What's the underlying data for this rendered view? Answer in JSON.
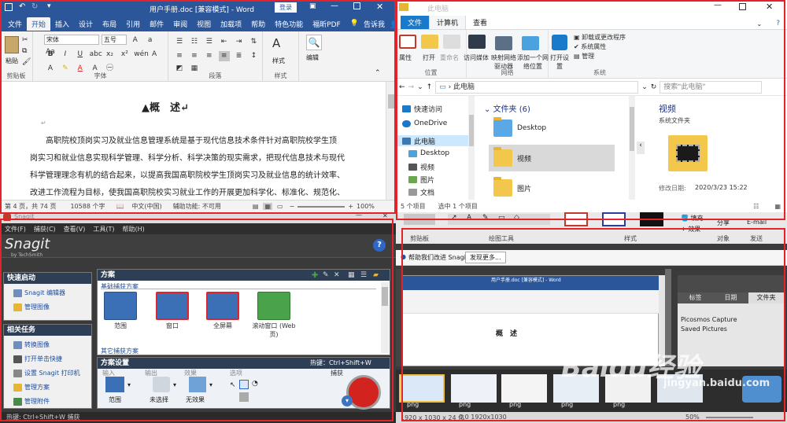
{
  "word": {
    "title": "用户手册.doc [兼容模式] - Word",
    "login": "登录",
    "tabs": [
      "文件",
      "开始",
      "插入",
      "设计",
      "布局",
      "引用",
      "邮件",
      "审阅",
      "视图",
      "加载项",
      "帮助",
      "特色功能",
      "福昕PDF"
    ],
    "tell_me": "告诉我",
    "share": "共享",
    "font_name": "宋体",
    "font_size": "五号",
    "paste": "粘贴",
    "styles": "样式",
    "edit": "编辑",
    "group_labels": [
      "剪贴板",
      "字体",
      "段落",
      "样式"
    ],
    "heading": "▲概　述↵",
    "paragraph_lines": [
      "高职院校顶岗实习及就业信息管理系统是基于现代信息技术条件针对高职院校学生顶",
      "岗实习和就业信息实现科学管理、科学分析、科学决策的现实需求，把现代信息技术与现代",
      "科学管理理念有机的结合起来，以提高我国高职院校学生顶岗实习及就业信息的统计效率、",
      "改进工作流程为目标，使我国高职院校实习就业工作的开展更加科学化、标准化、规范化、"
    ],
    "status": {
      "page": "第 4 页，共 74 页",
      "words": "10588 个字",
      "lang": "中文(中国)",
      "accessibility": "辅助功能: 不可用",
      "zoom": "100%"
    }
  },
  "explorer": {
    "title": "此电脑",
    "tabs": [
      "文件",
      "计算机",
      "查看"
    ],
    "ribbon_items": [
      "属性",
      "打开",
      "重命名",
      "访问媒体",
      "映射网络驱动器",
      "添加一个网络位置",
      "打开设置",
      "卸载或更改程序",
      "系统属性",
      "管理"
    ],
    "group_labels": [
      "位置",
      "网络",
      "系统"
    ],
    "address": "此电脑",
    "search_placeholder": "搜索\"此电脑\"",
    "nav_items": [
      "快速访问",
      "OneDrive",
      "此电脑",
      "Desktop",
      "视频",
      "图片",
      "文档"
    ],
    "section": "文件夹 (6)",
    "folders": [
      "Desktop",
      "视频",
      "图片"
    ],
    "preview": {
      "name": "视频",
      "type": "系统文件夹",
      "modified_label": "修改日期:",
      "modified": "2020/3/23 15:22"
    },
    "status": {
      "count": "5 个项目",
      "selected": "选中 1 个项目"
    }
  },
  "snagit": {
    "title": "Snagit",
    "menu": [
      "文件(F)",
      "捕获(C)",
      "查看(V)",
      "工具(T)",
      "帮助(H)"
    ],
    "logo": "Snagit",
    "logo_sub": "by TechSmith",
    "quick_start": {
      "title": "快速启动",
      "items": [
        "Snagit 编辑器",
        "管理图像"
      ]
    },
    "related": {
      "title": "相关任务",
      "items": [
        "转换图像",
        "打开单击快捷",
        "设置 Snagit 打印机",
        "管理方案",
        "管理附件"
      ]
    },
    "schemes": {
      "title": "方案",
      "basic": "基础捕获方案",
      "other": "其它捕获方案",
      "presets": [
        "范围",
        "窗口",
        "全屏幕",
        "滚动窗口 (Web\n页)"
      ]
    },
    "settings": {
      "title": "方案设置",
      "hotkey": "热键：Ctrl+Shift+W",
      "input": "输入",
      "output": "输出",
      "effect": "效果",
      "options": "选项",
      "capture": "捕获",
      "values": [
        "范围",
        "未选择",
        "无效果"
      ]
    },
    "status": "热键: Ctrl+Shift+W 捕获"
  },
  "editor": {
    "ribbon_labels": [
      "剪贴板",
      "绘图工具",
      "样式",
      "对象",
      "发送"
    ],
    "fill": "填充",
    "effects": "效果",
    "share": "分享",
    "email": "E-mail",
    "help_text": "帮助我们改进 Snagit",
    "discover": "发现更多...",
    "tabs": [
      "标签",
      "日期",
      "文件夹"
    ],
    "tree": [
      "Picosmos Capture",
      "Saved Pictures"
    ],
    "thumb_label": "png",
    "status": {
      "size": "1920 x 1030 x 24 位",
      "pos": "0,0  1920x1030",
      "zoom": "50%"
    },
    "inner_doc_title": "用户手册.doc [兼容模式] - Word",
    "inner_heading": "概　述",
    "watermark": "Baidu经验",
    "watermark_url": "jingyan.baidu.com"
  }
}
